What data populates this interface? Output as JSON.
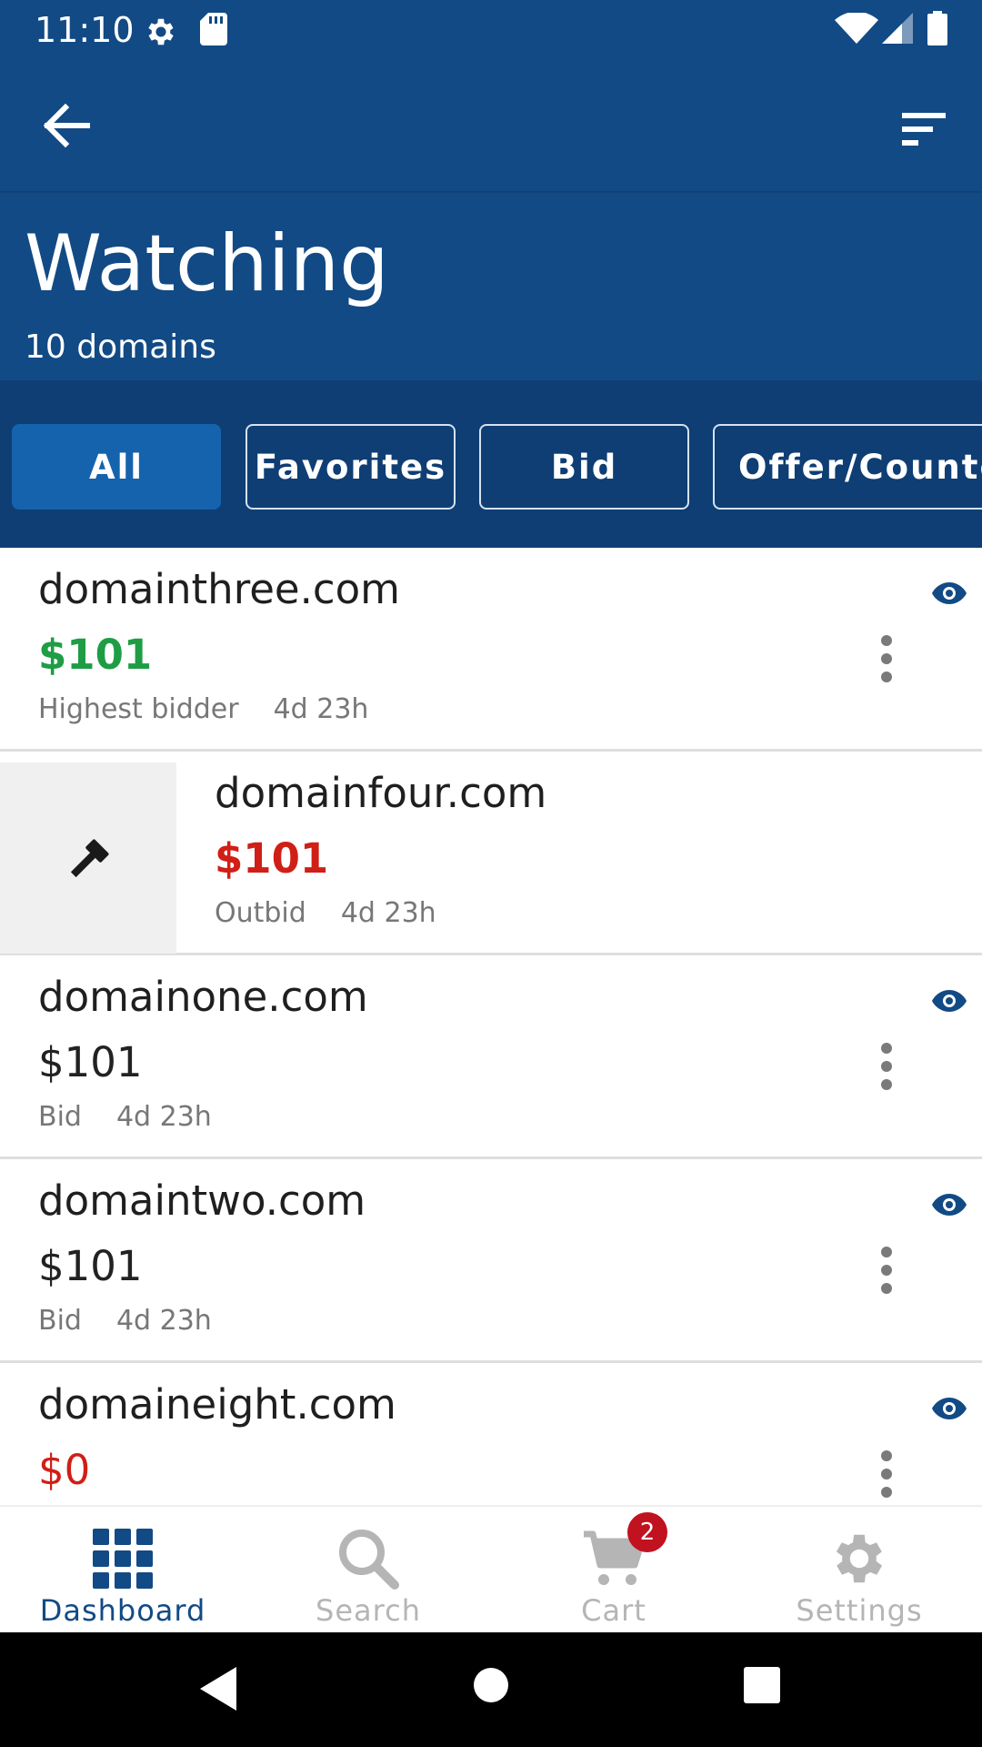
{
  "status_bar": {
    "time": "11:10"
  },
  "header": {
    "title": "Watching",
    "subtitle": "10 domains"
  },
  "filters": [
    "All",
    "Favorites",
    "Bid",
    "Offer/Counter"
  ],
  "domains": [
    {
      "name": "domainthree.com",
      "price": "$101",
      "status": "Highest bidder",
      "time_left": "4d 23h"
    },
    {
      "name": "domainfour.com",
      "price": "$101",
      "status": "Outbid",
      "time_left": "4d 23h"
    },
    {
      "name": "domainone.com",
      "price": "$101",
      "status": "Bid",
      "time_left": "4d 23h"
    },
    {
      "name": "domaintwo.com",
      "price": "$101",
      "status": "Bid",
      "time_left": "4d 23h"
    },
    {
      "name": "domaineight.com",
      "price": "$0",
      "status": "",
      "time_left": ""
    }
  ],
  "bottom_nav": {
    "dashboard": "Dashboard",
    "search": "Search",
    "cart": "Cart",
    "cart_badge": "2",
    "settings": "Settings"
  },
  "colors": {
    "primary": "#124a85",
    "filter_bar": "#0e3e74",
    "active_chip": "#1563ad",
    "green": "#1f9d45",
    "red": "#d01f16",
    "badge": "#c1121f"
  }
}
